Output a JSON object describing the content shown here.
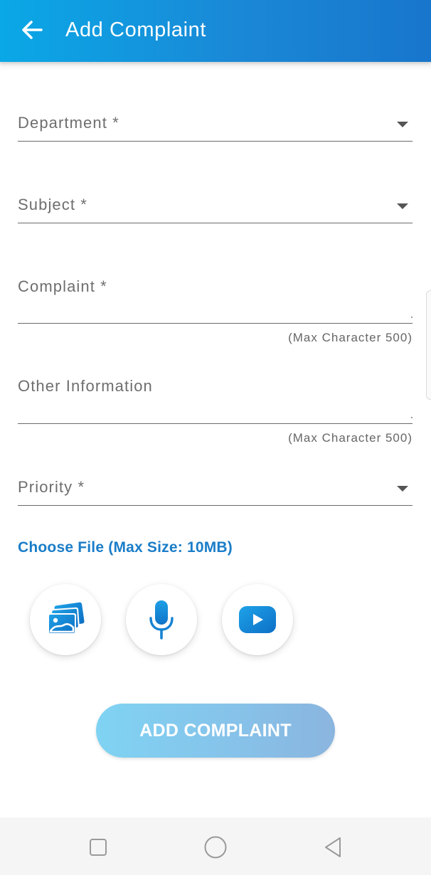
{
  "app_bar": {
    "title": "Add Complaint",
    "back_icon": "arrow-left-icon",
    "gradient": [
      "#0aa8e6",
      "#1876cc"
    ]
  },
  "form": {
    "department": {
      "label": "Department *",
      "icon": "dropdown-arrow-icon"
    },
    "subject": {
      "label": "Subject *",
      "icon": "dropdown-arrow-icon"
    },
    "complaint": {
      "label": "Complaint *",
      "helper": "(Max Character 500)"
    },
    "other_information": {
      "label": "Other Information",
      "helper": "(Max Character 500)"
    },
    "priority": {
      "label": "Priority *",
      "icon": "dropdown-arrow-icon"
    }
  },
  "attachments": {
    "label": "Choose File (Max Size: 10MB)",
    "accent": "#1a7dc8",
    "buttons": [
      {
        "icon": "image-gallery-icon"
      },
      {
        "icon": "microphone-icon"
      },
      {
        "icon": "video-play-icon"
      }
    ]
  },
  "submit": {
    "label": "ADD COMPLAINT",
    "gradient": [
      "#7fd3f3",
      "#8ab5df"
    ]
  },
  "system_nav": {
    "buttons": [
      {
        "icon": "recent-apps-icon"
      },
      {
        "icon": "home-circle-icon"
      },
      {
        "icon": "back-triangle-icon"
      }
    ]
  }
}
